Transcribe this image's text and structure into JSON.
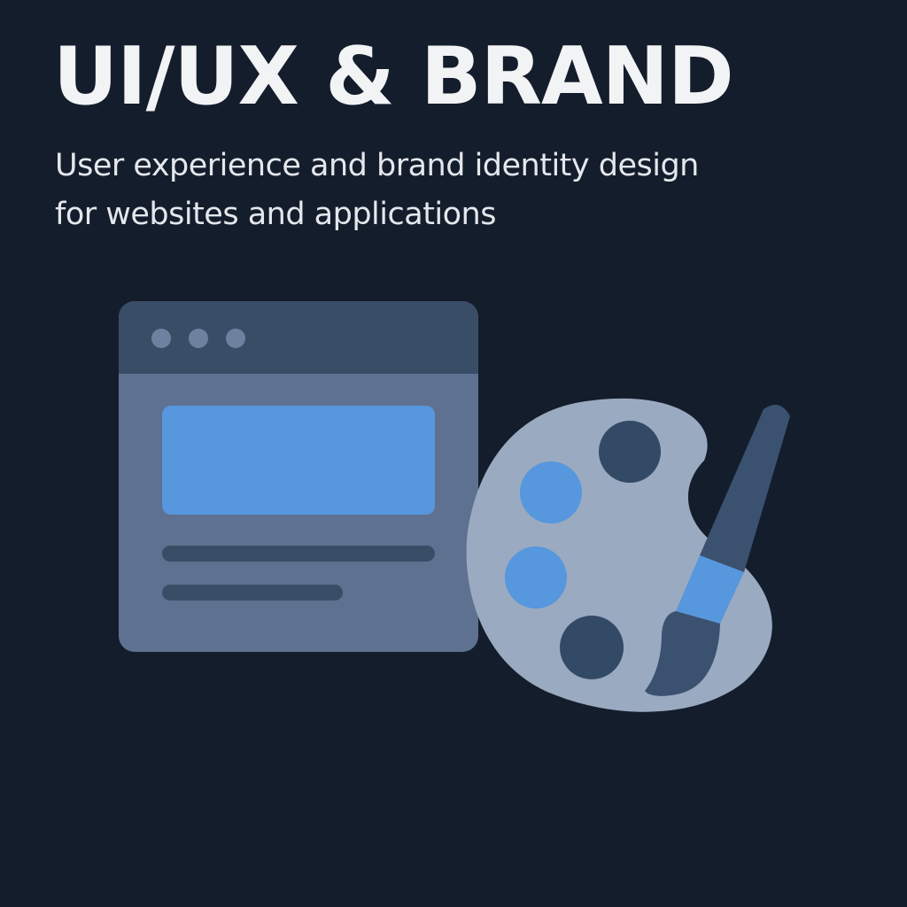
{
  "header": {
    "title": "UI/UX & BRAND",
    "subtitle_lines": [
      "User experience and brand identity design",
      "for websites and applications"
    ]
  },
  "illustration": {
    "icons": [
      "browser-window-icon",
      "paint-palette-icon",
      "paintbrush-icon"
    ]
  },
  "colors": {
    "background": "#141d2b",
    "title_text": "#f2f3f5",
    "subtitle_text": "#e4e7ec",
    "window_titlebar": "#3a4d66",
    "window_body": "#5f7190",
    "window_dots": "#6e82a0",
    "accent_blue": "#5697de",
    "content_lines": "#3a4d66",
    "palette_body": "#9aaac0",
    "paint_dark": "#334a66",
    "brush_handle": "#3a5170"
  }
}
